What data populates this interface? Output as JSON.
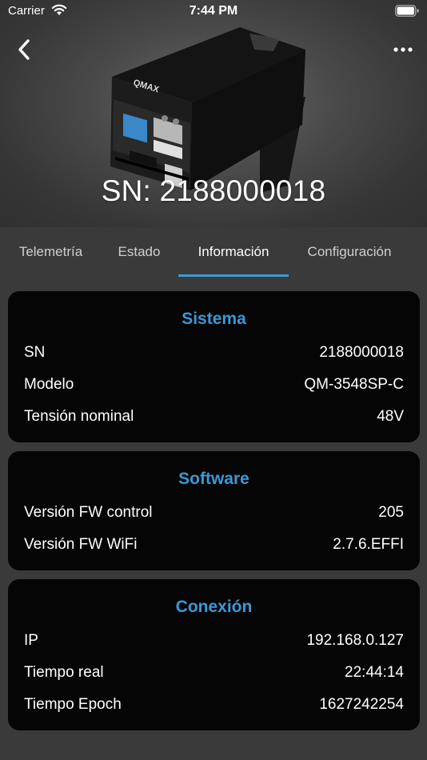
{
  "status_bar": {
    "carrier": "Carrier",
    "time": "7:44 PM"
  },
  "header": {
    "title": "SN: 2188000018",
    "device_brand": "QMAX"
  },
  "tabs": [
    {
      "label": "Telemetría",
      "active": false
    },
    {
      "label": "Estado",
      "active": false
    },
    {
      "label": "Información",
      "active": true
    },
    {
      "label": "Configuración",
      "active": false
    }
  ],
  "sections": {
    "sistema": {
      "title": "Sistema",
      "rows": [
        {
          "label": "SN",
          "value": "2188000018"
        },
        {
          "label": "Modelo",
          "value": "QM-3548SP-C"
        },
        {
          "label": "Tensión nominal",
          "value": "48V"
        }
      ]
    },
    "software": {
      "title": "Software",
      "rows": [
        {
          "label": "Versión FW control",
          "value": "205"
        },
        {
          "label": "Versión FW WiFi",
          "value": "2.7.6.EFFI"
        }
      ]
    },
    "conexion": {
      "title": "Conexión",
      "rows": [
        {
          "label": "IP",
          "value": "192.168.0.127"
        },
        {
          "label": "Tiempo real",
          "value": "22:44:14"
        },
        {
          "label": "Tiempo Epoch",
          "value": "1627242254"
        }
      ]
    }
  },
  "colors": {
    "accent": "#3a99d8",
    "background": "#3a3a3a",
    "card": "#050505"
  },
  "icons": {
    "back": "chevron-left-icon",
    "more": "ellipsis-icon",
    "wifi": "wifi-icon",
    "battery": "battery-icon"
  }
}
